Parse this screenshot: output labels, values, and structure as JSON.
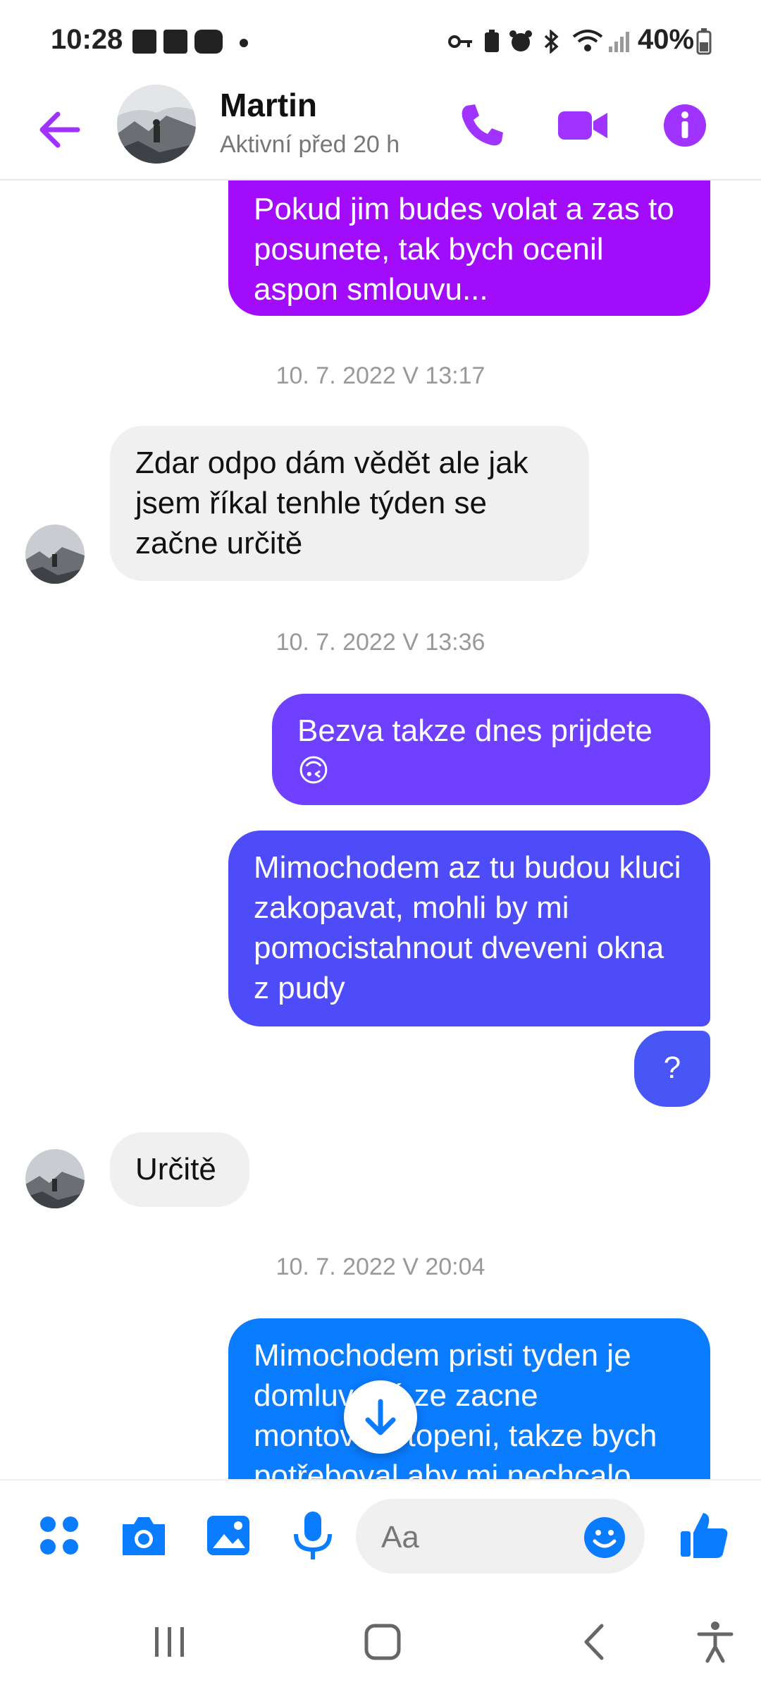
{
  "status_bar": {
    "time": "10:28",
    "battery": "40%"
  },
  "header": {
    "contact_name": "Martin",
    "contact_status": "Aktivní před 20 h"
  },
  "colors": {
    "accent": "#a033ff",
    "bubble_purple": "#a10dfb",
    "bubble_violet": "#6f40ff",
    "bubble_indigo": "#4e4cf8",
    "bubble_blue": "#0a7cff",
    "incoming": "#f0f0f0"
  },
  "messages": [
    {
      "type": "outgoing",
      "text": "Pokud jim budes volat a zas to posunete, tak bych ocenil aspon smlouvu..."
    },
    {
      "type": "timestamp",
      "text": "10. 7. 2022 V 13:17"
    },
    {
      "type": "incoming",
      "text": "Zdar odpo dám vědět ale jak jsem říkal tenhle týden se začne určitě"
    },
    {
      "type": "timestamp",
      "text": "10. 7. 2022 V 13:36"
    },
    {
      "type": "outgoing",
      "text": "Bezva takze dnes prijdete",
      "emoji": "🙃"
    },
    {
      "type": "outgoing",
      "text": "Mimochodem az tu budou kluci zakopavat, mohli by mi pomocistahnout dveveni okna z pudy"
    },
    {
      "type": "outgoing",
      "text": "?"
    },
    {
      "type": "incoming",
      "text": "Určitě"
    },
    {
      "type": "timestamp",
      "text": "10. 7. 2022 V 20:04"
    },
    {
      "type": "outgoing",
      "text": "Mimochodem pristi tyden je domluvené ze zacne montování topeni, takze bych potřeboval aby mi nechcalo"
    }
  ],
  "composer": {
    "placeholder": "Aa"
  }
}
